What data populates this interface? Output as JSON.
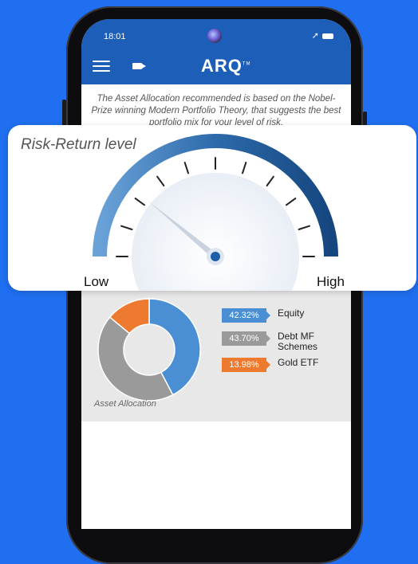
{
  "status": {
    "time": "18:01"
  },
  "header": {
    "logo": "ARQ",
    "logo_tm": "TM"
  },
  "intro_text": "The Asset Allocation recommended is based on the Nobel-Prize winning Modern Portfolio Theory, that suggests the best portfolio mix for your level of risk.",
  "risk_card": {
    "title": "Risk-Return level",
    "low_label": "Low",
    "high_label": "High",
    "needle_level": 0.22
  },
  "allocation": {
    "caption": "Asset Allocation",
    "items": [
      {
        "value": "42.32%",
        "label": "Equity",
        "pct": 42.32,
        "color": "#4a8fd4"
      },
      {
        "value": "43.70%",
        "label": "Debt MF Schemes",
        "pct": 43.7,
        "color": "#9a9a9a"
      },
      {
        "value": "13.98%",
        "label": "Gold ETF",
        "pct": 13.98,
        "color": "#ee7a2f"
      }
    ]
  },
  "colors": {
    "background": "#1f6ff0",
    "appbar": "#1d5fb8",
    "gauge_dark": "#1c4f8f",
    "gauge_light": "#5a93cc"
  }
}
